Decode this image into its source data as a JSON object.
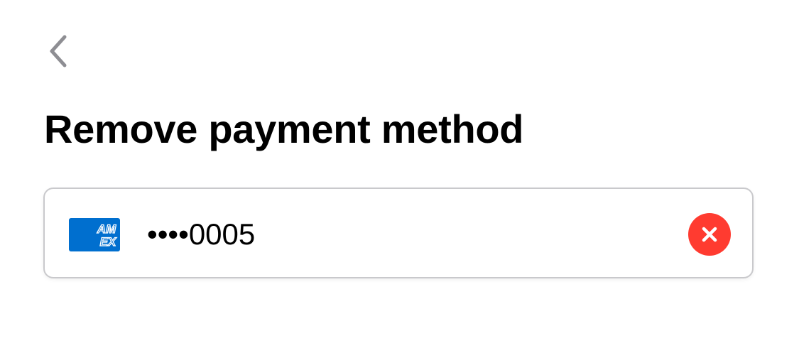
{
  "header": {
    "back_icon": "chevron-left-icon",
    "title": "Remove payment method"
  },
  "payment_method": {
    "brand": "American Express",
    "brand_logo_text_top": "AM",
    "brand_logo_text_bottom": "EX",
    "masked_number": "••••0005",
    "remove_icon": "close-icon"
  },
  "colors": {
    "amex_blue": "#006fcf",
    "remove_red": "#ff3b30",
    "back_chevron": "#8e8e93",
    "card_border": "#c9c9cc"
  }
}
